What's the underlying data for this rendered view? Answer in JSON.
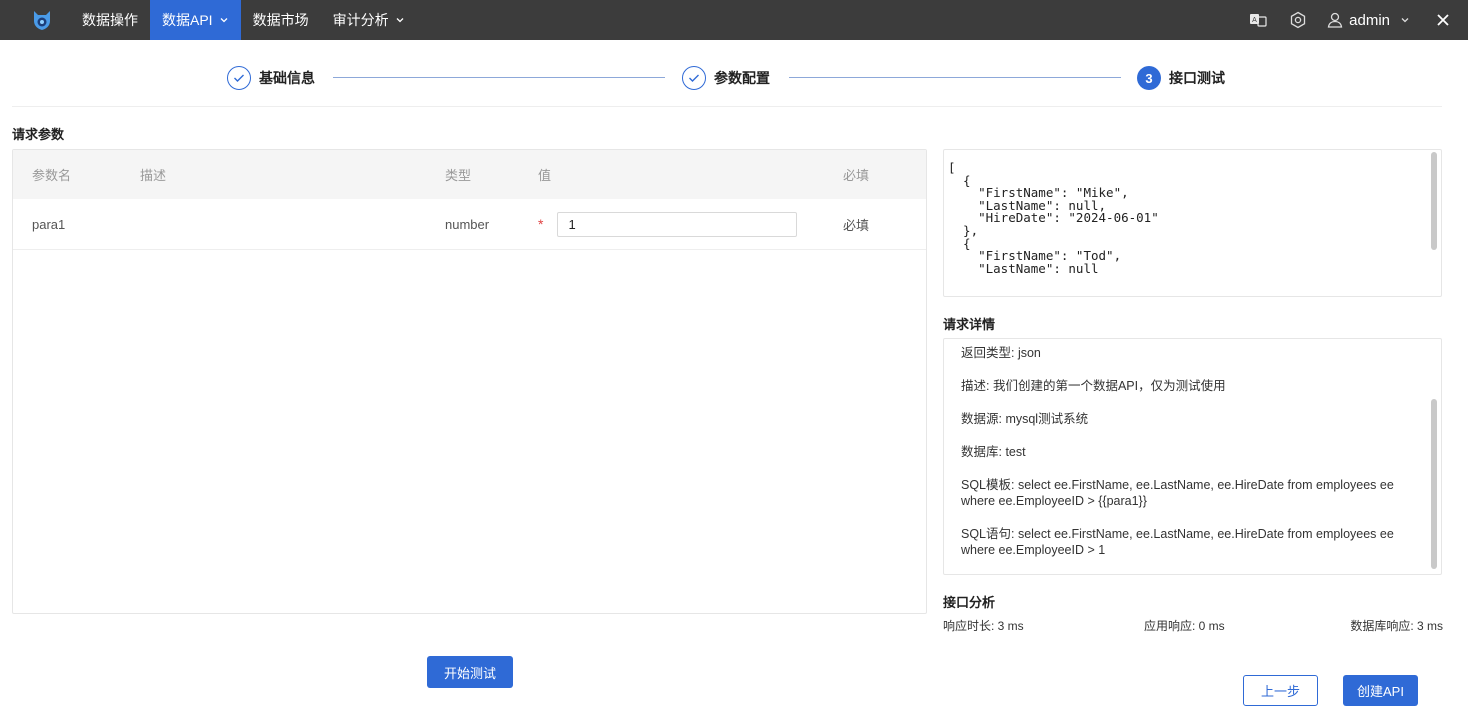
{
  "nav": {
    "items": [
      {
        "label": "数据操作",
        "active": false,
        "has_dropdown": false
      },
      {
        "label": "数据API",
        "active": true,
        "has_dropdown": true
      },
      {
        "label": "数据市场",
        "active": false,
        "has_dropdown": false
      },
      {
        "label": "审计分析",
        "active": false,
        "has_dropdown": true
      }
    ],
    "user": "admin",
    "accent_color": "#2f6ad6",
    "bar_color": "#3c3c3c"
  },
  "steps": [
    {
      "label": "基础信息",
      "status": "done"
    },
    {
      "label": "参数配置",
      "status": "done"
    },
    {
      "number": "3",
      "label": "接口测试",
      "status": "current"
    }
  ],
  "request_params": {
    "title": "请求参数",
    "columns": [
      "参数名",
      "描述",
      "类型",
      "值",
      "必填"
    ],
    "rows": [
      {
        "name": "para1",
        "description": "",
        "type": "number",
        "value": "1",
        "required": "必填"
      }
    ]
  },
  "start_test_button": "开始测试",
  "response_json": "[\n  {\n    \"FirstName\": \"Mike\",\n    \"LastName\": null,\n    \"HireDate\": \"2024-06-01\"\n  },\n  {\n    \"FirstName\": \"Tod\",\n    \"LastName\": null",
  "request_details": {
    "title": "请求详情",
    "items": [
      "返回类型: json",
      "描述: 我们创建的第一个数据API，仅为测试使用",
      "数据源: mysql测试系统",
      "数据库: test",
      "SQL模板: select ee.FirstName, ee.LastName, ee.HireDate from employees ee where ee.EmployeeID > {{para1}}",
      "SQL语句: select ee.FirstName, ee.LastName, ee.HireDate from employees ee where ee.EmployeeID > 1"
    ]
  },
  "analysis": {
    "title": "接口分析",
    "response_time": "响应时长: 3 ms",
    "app_response": "应用响应: 0 ms",
    "db_response": "数据库响应: 3 ms"
  },
  "footer": {
    "prev_button": "上一步",
    "create_button": "创建API"
  }
}
